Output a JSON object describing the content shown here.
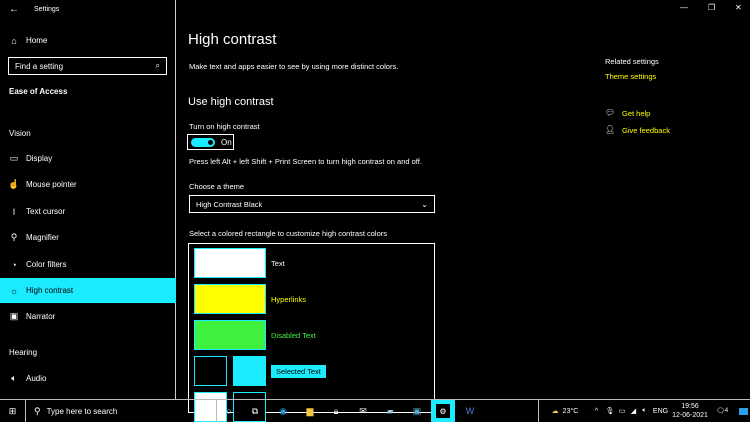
{
  "window": {
    "title": "Settings",
    "minimize": "—",
    "maximize": "❐",
    "close": "✕"
  },
  "sidebar": {
    "home": "Home",
    "search_placeholder": "Find a setting",
    "category": "Ease of Access",
    "vision_header": "Vision",
    "items": [
      {
        "label": "Display",
        "icon": "display-icon"
      },
      {
        "label": "Mouse pointer",
        "icon": "mouse-pointer-icon"
      },
      {
        "label": "Text cursor",
        "icon": "text-cursor-icon"
      },
      {
        "label": "Magnifier",
        "icon": "magnifier-icon"
      },
      {
        "label": "Color filters",
        "icon": "color-filters-icon"
      },
      {
        "label": "High contrast",
        "icon": "brightness-icon",
        "active": true
      },
      {
        "label": "Narrator",
        "icon": "narrator-icon"
      }
    ],
    "hearing_header": "Hearing",
    "hearing_items": [
      {
        "label": "Audio",
        "icon": "speaker-icon"
      }
    ]
  },
  "main": {
    "title": "High contrast",
    "description": "Make text and apps easier to see by using more distinct colors.",
    "section_title": "Use high contrast",
    "toggle_label": "Turn on high contrast",
    "toggle_state": "On",
    "shortcut_hint": "Press left Alt + left Shift + Print Screen to turn high contrast on and off.",
    "theme_label": "Choose a theme",
    "theme_value": "High Contrast Black",
    "colors_label": "Select a colored rectangle to customize high contrast colors",
    "colors": [
      {
        "label": "Text",
        "color": "#ffffff"
      },
      {
        "label": "Hyperlinks",
        "color": "#ffff00"
      },
      {
        "label": "Disabled Text",
        "color": "#3ff23f"
      },
      {
        "label": "Selected Text",
        "fg": "#000000",
        "bg": "#1aebff"
      }
    ]
  },
  "related": {
    "header": "Related settings",
    "theme_settings": "Theme settings",
    "get_help": "Get help",
    "give_feedback": "Give feedback"
  },
  "taskbar": {
    "search_placeholder": "Type here to search",
    "weather": "23°C",
    "language": "ENG",
    "time": "19:56",
    "date": "12-06-2021",
    "notifications": "4"
  },
  "colors": {
    "accent": "#1aebff",
    "link": "#ffff00",
    "background": "#000000"
  }
}
